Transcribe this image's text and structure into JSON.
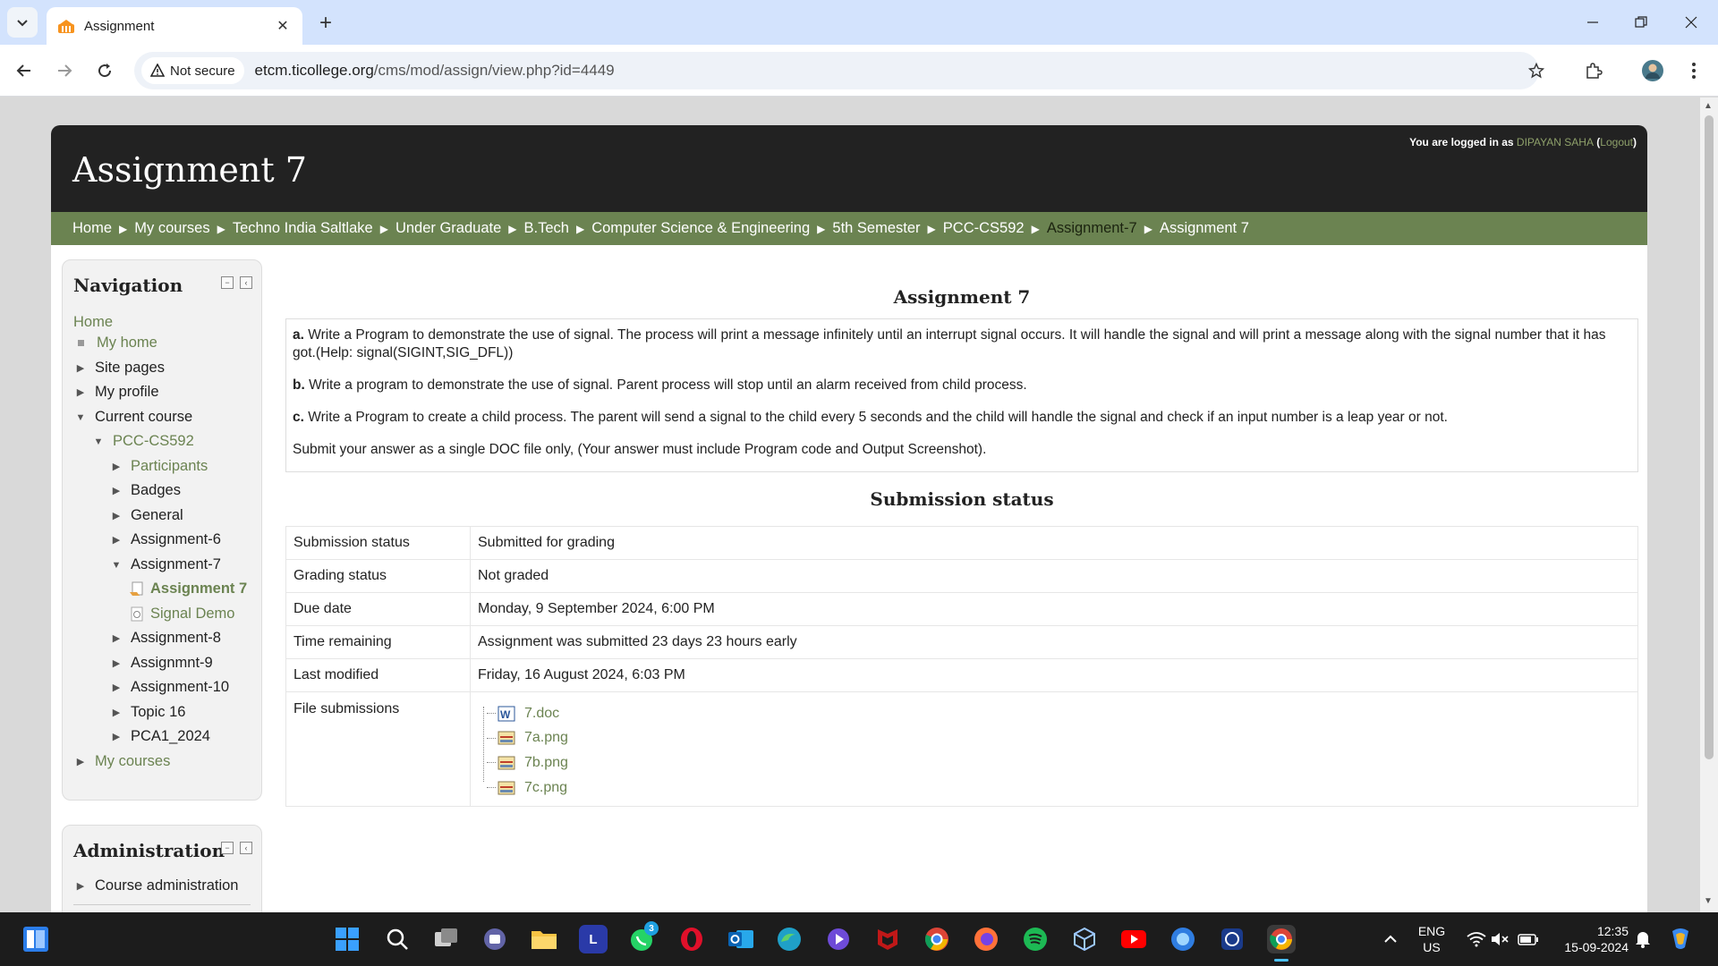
{
  "browser": {
    "tab_title": "Assignment",
    "security_label": "Not secure",
    "url_host": "etcm.ticollege.org",
    "url_path": "/cms/mod/assign/view.php?id=4449"
  },
  "header": {
    "site_title": "Assignment 7",
    "logged_in_prefix": "You are logged in as",
    "user_name": "DIPAYAN SAHA",
    "logout_label": "Logout"
  },
  "breadcrumb": [
    {
      "label": "Home"
    },
    {
      "label": "My courses"
    },
    {
      "label": "Techno India Saltlake"
    },
    {
      "label": "Under Graduate"
    },
    {
      "label": "B.Tech"
    },
    {
      "label": "Computer Science & Engineering"
    },
    {
      "label": "5th Semester"
    },
    {
      "label": "PCC-CS592"
    },
    {
      "label": "Assignment-7"
    },
    {
      "label": "Assignment 7"
    }
  ],
  "navigation": {
    "title": "Navigation",
    "items": [
      {
        "label": "Home"
      },
      {
        "label": "My home"
      },
      {
        "label": "Site pages"
      },
      {
        "label": "My profile"
      },
      {
        "label": "Current course"
      },
      {
        "label": "PCC-CS592"
      },
      {
        "label": "Participants"
      },
      {
        "label": "Badges"
      },
      {
        "label": "General"
      },
      {
        "label": "Assignment-6"
      },
      {
        "label": "Assignment-7"
      },
      {
        "label": "Assignment 7"
      },
      {
        "label": "Signal Demo"
      },
      {
        "label": "Assignment-8"
      },
      {
        "label": "Assignmnt-9"
      },
      {
        "label": "Assignment-10"
      },
      {
        "label": "Topic 16"
      },
      {
        "label": "PCA1_2024"
      },
      {
        "label": "My courses"
      }
    ]
  },
  "administration": {
    "title": "Administration",
    "items": [
      {
        "label": "Course administration"
      }
    ]
  },
  "assignment": {
    "heading": "Assignment 7",
    "intro": [
      {
        "prefix": "a.",
        "text": "Write a Program to demonstrate the use of signal. The process will print a message infinitely until an interrupt signal occurs. It will handle the signal and will print a message along with the signal number that it has got.(Help: signal(SIGINT,SIG_DFL))"
      },
      {
        "prefix": "b.",
        "text": "Write a program to demonstrate the use of signal. Parent process will stop until an alarm received from child process."
      },
      {
        "prefix": "c.",
        "text": "Write a Program to create a child process. The parent will send a signal to the child every 5 seconds and the child will handle the signal and check if an input number is a leap year or not."
      },
      {
        "prefix": "",
        "text": "Submit your answer as a single DOC file only, (Your answer must include Program code and Output Screenshot)."
      }
    ]
  },
  "submission": {
    "heading": "Submission status",
    "rows": [
      {
        "label": "Submission status",
        "value": "Submitted for grading"
      },
      {
        "label": "Grading status",
        "value": "Not graded"
      },
      {
        "label": "Due date",
        "value": "Monday, 9 September 2024, 6:00 PM"
      },
      {
        "label": "Time remaining",
        "value": "Assignment was submitted 23 days 23 hours early"
      },
      {
        "label": "Last modified",
        "value": "Friday, 16 August 2024, 6:03 PM"
      }
    ],
    "files_label": "File submissions",
    "files": [
      {
        "name": "7.doc",
        "icon": "word-doc-icon"
      },
      {
        "name": "7a.png",
        "icon": "image-file-icon"
      },
      {
        "name": "7b.png",
        "icon": "image-file-icon"
      },
      {
        "name": "7c.png",
        "icon": "image-file-icon"
      }
    ]
  },
  "taskbar": {
    "line_app_label": "L",
    "whatsapp_badge": "3",
    "lang_top": "ENG",
    "lang_bottom": "US",
    "time": "12:35",
    "date": "15-09-2024"
  },
  "colors": {
    "breadcrumb_bar": "#6b8351",
    "header_bg": "#222222",
    "link": "#6b8351",
    "browser_tabbar": "#d3e3fd"
  }
}
